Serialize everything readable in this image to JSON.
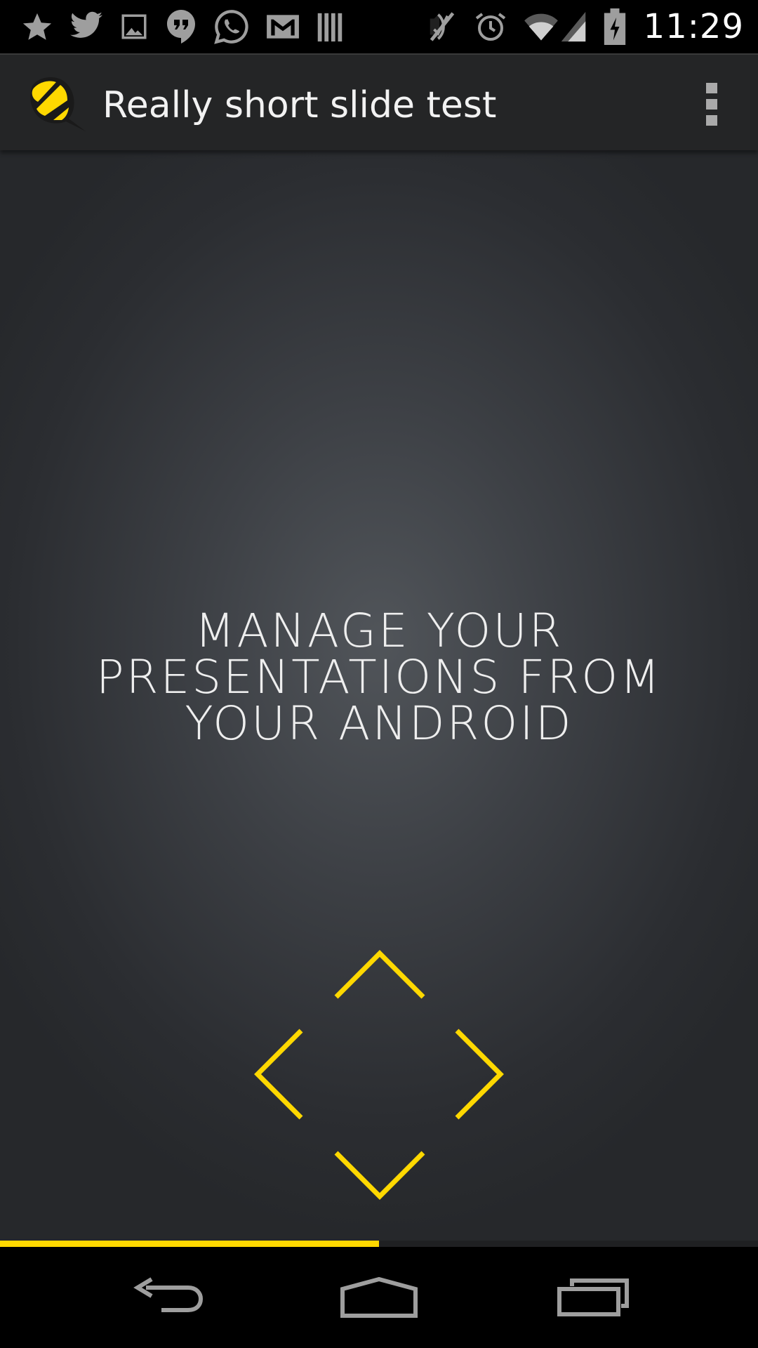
{
  "status_bar": {
    "time": "11:29",
    "notification_icons": [
      "star-icon",
      "twitter-icon",
      "image-icon",
      "hangouts-icon",
      "whatsapp-icon",
      "gmail-icon",
      "library-icon"
    ],
    "system_icons": [
      "mute-icon",
      "alarm-icon",
      "wifi-icon",
      "signal-icon",
      "battery-charging-icon"
    ]
  },
  "action_bar": {
    "title": "Really short slide test",
    "logo": "bee-logo-icon",
    "overflow": "overflow-menu-icon"
  },
  "slide": {
    "lines": [
      "MANAGE YOUR",
      "PRESENTATIONS FROM",
      "YOUR ANDROID"
    ]
  },
  "controls": {
    "icons": [
      "chevron-up-icon",
      "chevron-left-icon",
      "chevron-right-icon",
      "chevron-down-icon"
    ],
    "accent_color": "#ffd800"
  },
  "progress": {
    "fraction": 0.5
  },
  "nav_bar": {
    "icons": [
      "back-icon",
      "home-icon",
      "recents-icon"
    ]
  },
  "colors": {
    "accent": "#ffd800",
    "action_bar": "#242526",
    "status_bar": "#000000"
  }
}
